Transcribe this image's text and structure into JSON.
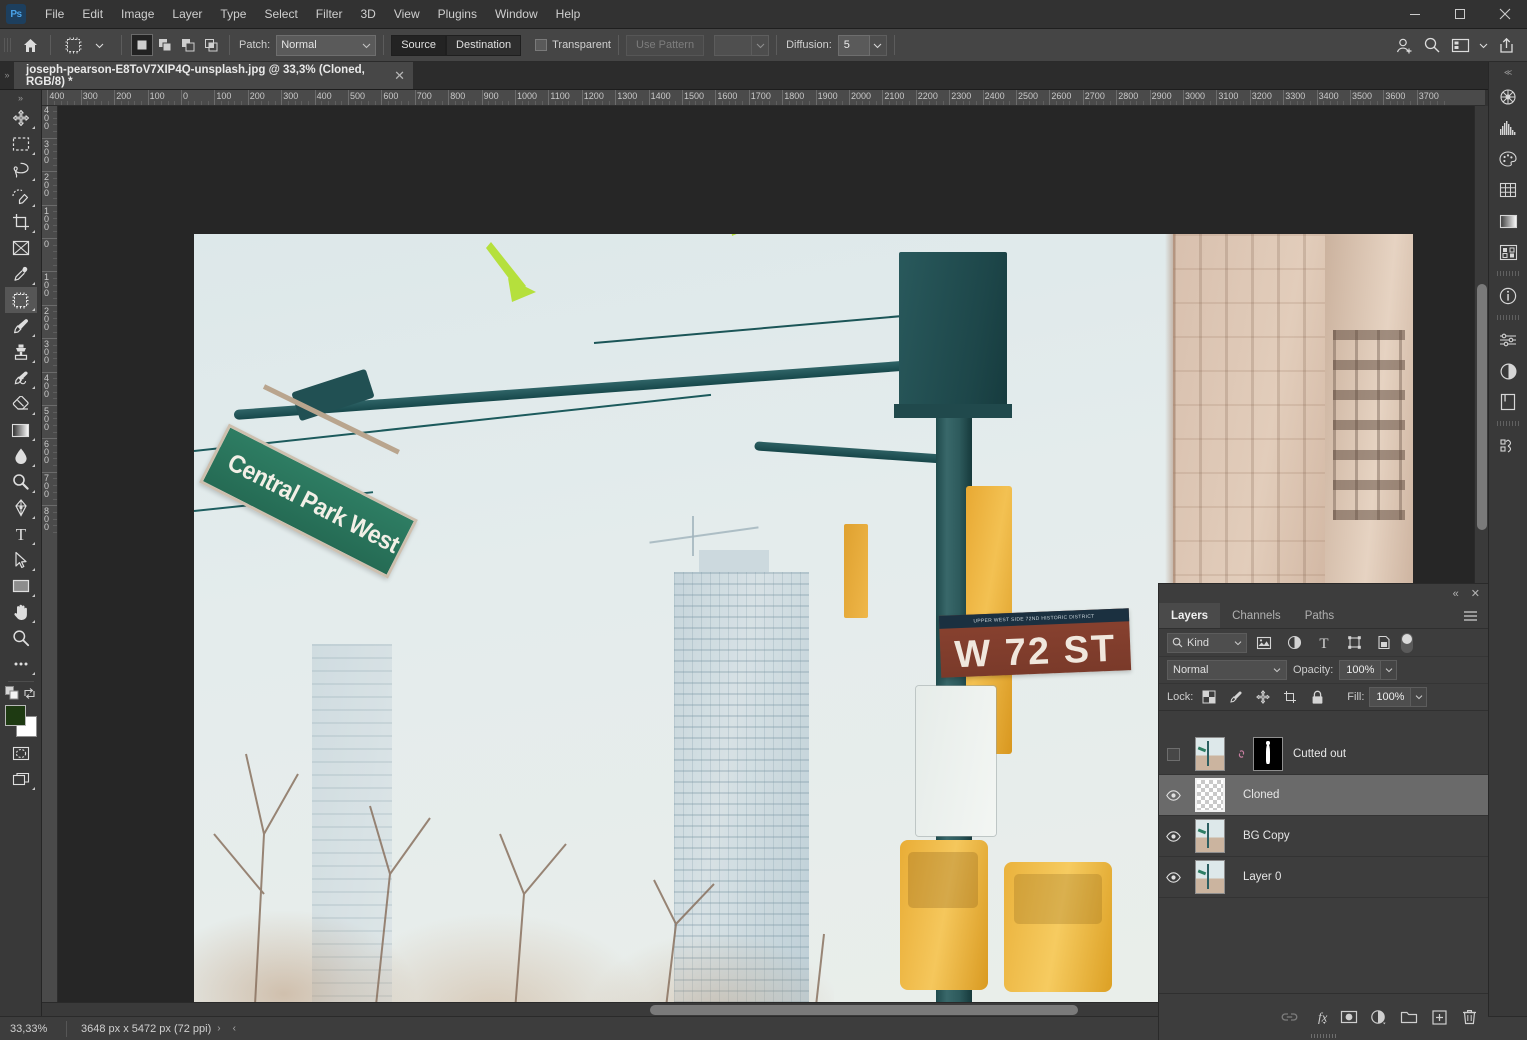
{
  "app": {
    "name": "Ps",
    "logo_text": "Ps"
  },
  "menubar": {
    "items": [
      {
        "label": "File"
      },
      {
        "label": "Edit"
      },
      {
        "label": "Image"
      },
      {
        "label": "Layer"
      },
      {
        "label": "Type"
      },
      {
        "label": "Select"
      },
      {
        "label": "Filter"
      },
      {
        "label": "3D"
      },
      {
        "label": "View"
      },
      {
        "label": "Plugins"
      },
      {
        "label": "Window"
      },
      {
        "label": "Help"
      }
    ],
    "window_controls": {
      "minimize": "—",
      "maximize": "❑",
      "close": "✕"
    }
  },
  "options_bar": {
    "home_icon": "home-icon",
    "tool_icon": "patch-tool-icon",
    "patch_label": "Patch:",
    "patch_mode": "Normal",
    "source_label": "Source",
    "destination_label": "Destination",
    "transparent_label": "Transparent",
    "use_pattern_label": "Use Pattern",
    "diffusion_label": "Diffusion:",
    "diffusion_value": "5",
    "right_icons": [
      "add-user-icon",
      "search-icon",
      "workspace-icon",
      "chevron-down-icon",
      "share-icon"
    ]
  },
  "document_tab": {
    "title": "joseph-pearson-E8ToV7XIP4Q-unsplash.jpg @ 33,3% (Cloned, RGB/8) *",
    "close_glyph": "✕"
  },
  "toolbar": {
    "tools": [
      {
        "name": "move-tool",
        "has_submenu": true
      },
      {
        "name": "rectangular-marquee-tool",
        "has_submenu": true
      },
      {
        "name": "lasso-tool",
        "has_submenu": true
      },
      {
        "name": "quick-selection-tool",
        "has_submenu": true
      },
      {
        "name": "crop-tool",
        "has_submenu": true
      },
      {
        "name": "frame-tool",
        "has_submenu": false
      },
      {
        "name": "eyedropper-tool",
        "has_submenu": true
      },
      {
        "name": "patch-tool",
        "has_submenu": true,
        "active": true
      },
      {
        "name": "brush-tool",
        "has_submenu": true
      },
      {
        "name": "clone-stamp-tool",
        "has_submenu": true
      },
      {
        "name": "history-brush-tool",
        "has_submenu": true
      },
      {
        "name": "eraser-tool",
        "has_submenu": true
      },
      {
        "name": "gradient-tool",
        "has_submenu": true
      },
      {
        "name": "blur-tool",
        "has_submenu": true
      },
      {
        "name": "dodge-tool",
        "has_submenu": true
      },
      {
        "name": "pen-tool",
        "has_submenu": true
      },
      {
        "name": "type-tool",
        "has_submenu": true
      },
      {
        "name": "path-selection-tool",
        "has_submenu": true
      },
      {
        "name": "rectangle-tool",
        "has_submenu": true
      },
      {
        "name": "hand-tool",
        "has_submenu": true
      },
      {
        "name": "zoom-tool",
        "has_submenu": false
      },
      {
        "name": "edit-toolbar-more",
        "has_submenu": true
      }
    ],
    "foreground_color": "#1e3a12",
    "background_color": "#ffffff",
    "quick_mask_name": "quick-mask-toggle",
    "screen_mode_name": "screen-mode-toggle"
  },
  "rulers": {
    "unit": "px",
    "horizontal_labels": [
      "400",
      "300",
      "200",
      "100",
      "0",
      "100",
      "200",
      "300",
      "400",
      "500",
      "600",
      "700",
      "800",
      "900",
      "1000",
      "1100",
      "1200",
      "1300",
      "1400",
      "1500",
      "1600",
      "1700",
      "1800",
      "1900",
      "2000",
      "2100",
      "2200",
      "2300",
      "2400",
      "2500",
      "2600",
      "2700",
      "2800",
      "2900",
      "3000",
      "3100",
      "3200",
      "3300",
      "3400",
      "3500",
      "3600",
      "3700"
    ],
    "horizontal_zero_index": 4,
    "vertical_labels": [
      "400",
      "300",
      "200",
      "100",
      "0",
      "100",
      "200",
      "300",
      "400",
      "500",
      "600",
      "700",
      "800"
    ],
    "vertical_zero_index": 4
  },
  "canvas": {
    "image_description": "Street photo of a traffic-signal pole at Central Park West and W 72 St",
    "street_sign_green": "Central Park West",
    "street_sign_brown_top": "UPPER WEST SIDE 72ND HISTORIC DISTRICT",
    "street_sign_brown": "W 72 ST",
    "annotation_arrows": [
      {
        "name": "annotation-arrow-1",
        "color": "#b5e03c"
      },
      {
        "name": "annotation-arrow-2",
        "color": "#b5e03c"
      }
    ],
    "annotation_color": "#b5e03c"
  },
  "statusbar": {
    "zoom": "33,33%",
    "dimensions": "3648 px x 5472 px (72 ppi)",
    "next_glyph": "›",
    "prev_glyph": "‹"
  },
  "right_dock": {
    "icons": [
      {
        "name": "color-wheel-icon"
      },
      {
        "name": "histogram-icon"
      },
      {
        "name": "swatches-icon"
      },
      {
        "name": "patterns-grid-icon"
      },
      {
        "name": "gradients-icon"
      },
      {
        "name": "shapes-icon"
      },
      {
        "name": "info-icon"
      },
      {
        "name": "adjustments-icon"
      },
      {
        "name": "adjustment-layer-icon"
      },
      {
        "name": "libraries-icon"
      },
      {
        "name": "history-icon"
      }
    ],
    "collapse_glyph": "«",
    "close_glyph": "✕"
  },
  "layers_panel": {
    "tabs": [
      {
        "label": "Layers",
        "active": true
      },
      {
        "label": "Channels",
        "active": false
      },
      {
        "label": "Paths",
        "active": false
      }
    ],
    "menu_glyph": "≡",
    "filter": {
      "kind_label": "Kind",
      "search_icon": "search-icon",
      "type_filters": [
        {
          "name": "filter-pixel-layers-icon"
        },
        {
          "name": "filter-adjustment-layers-icon"
        },
        {
          "name": "filter-type-layers-icon"
        },
        {
          "name": "filter-shape-layers-icon"
        },
        {
          "name": "filter-smart-object-icon"
        }
      ],
      "toggle_name": "filter-enable-toggle"
    },
    "blend_mode": "Normal",
    "opacity_label": "Opacity:",
    "opacity_value": "100%",
    "lock_label": "Lock:",
    "lock_buttons": [
      {
        "name": "lock-transparent-pixels-icon"
      },
      {
        "name": "lock-image-pixels-icon"
      },
      {
        "name": "lock-position-icon"
      },
      {
        "name": "lock-artboard-nesting-icon"
      },
      {
        "name": "lock-all-icon"
      }
    ],
    "fill_label": "Fill:",
    "fill_value": "100%",
    "layers": [
      {
        "name": "Cutted out",
        "visible": false,
        "selected": false,
        "has_mask": true,
        "linked": true,
        "thumb": "photo"
      },
      {
        "name": "Cloned",
        "visible": true,
        "selected": true,
        "has_mask": false,
        "linked": false,
        "thumb": "transparent"
      },
      {
        "name": "BG Copy",
        "visible": true,
        "selected": false,
        "has_mask": false,
        "linked": false,
        "thumb": "photo"
      },
      {
        "name": "Layer 0",
        "visible": true,
        "selected": false,
        "has_mask": false,
        "linked": false,
        "thumb": "photo"
      }
    ],
    "footer_buttons": [
      {
        "name": "link-layers-button",
        "disabled": true
      },
      {
        "name": "layer-style-fx-button",
        "disabled": false
      },
      {
        "name": "add-layer-mask-button",
        "disabled": false
      },
      {
        "name": "new-adjustment-layer-button",
        "disabled": false
      },
      {
        "name": "new-group-button",
        "disabled": false
      },
      {
        "name": "new-layer-button",
        "disabled": false
      },
      {
        "name": "delete-layer-button",
        "disabled": false
      }
    ]
  }
}
